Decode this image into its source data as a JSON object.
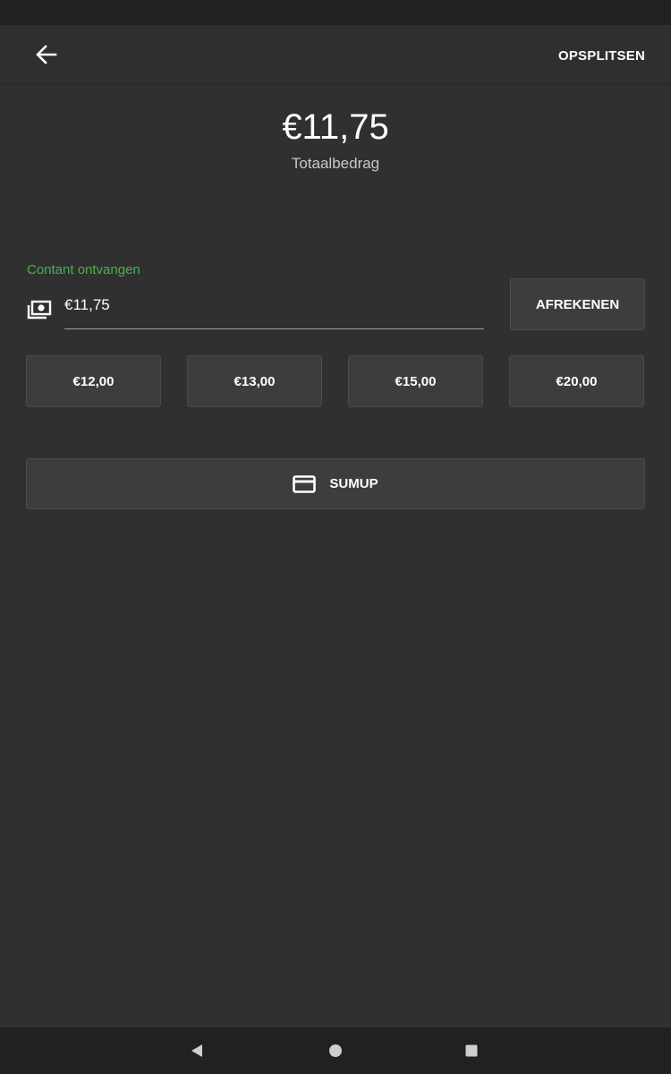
{
  "header": {
    "split_label": "OPSPLITSEN",
    "back_icon": "arrow-left-icon"
  },
  "total": {
    "amount": "€11,75",
    "label": "Totaalbedrag"
  },
  "cash": {
    "label": "Contant ontvangen",
    "value": "€11,75",
    "icon": "cash-icon",
    "checkout_label": "AFREKENEN"
  },
  "quick_amounts": [
    "€12,00",
    "€13,00",
    "€15,00",
    "€20,00"
  ],
  "sumup": {
    "label": "SUMUP",
    "icon": "credit-card-icon"
  },
  "nav": {
    "icons": [
      "nav-back-icon",
      "nav-home-icon",
      "nav-recents-icon"
    ]
  },
  "colors": {
    "background": "#303030",
    "accent_green": "#4caf50",
    "button": "#3d3d3d",
    "system_bar": "#212121"
  }
}
